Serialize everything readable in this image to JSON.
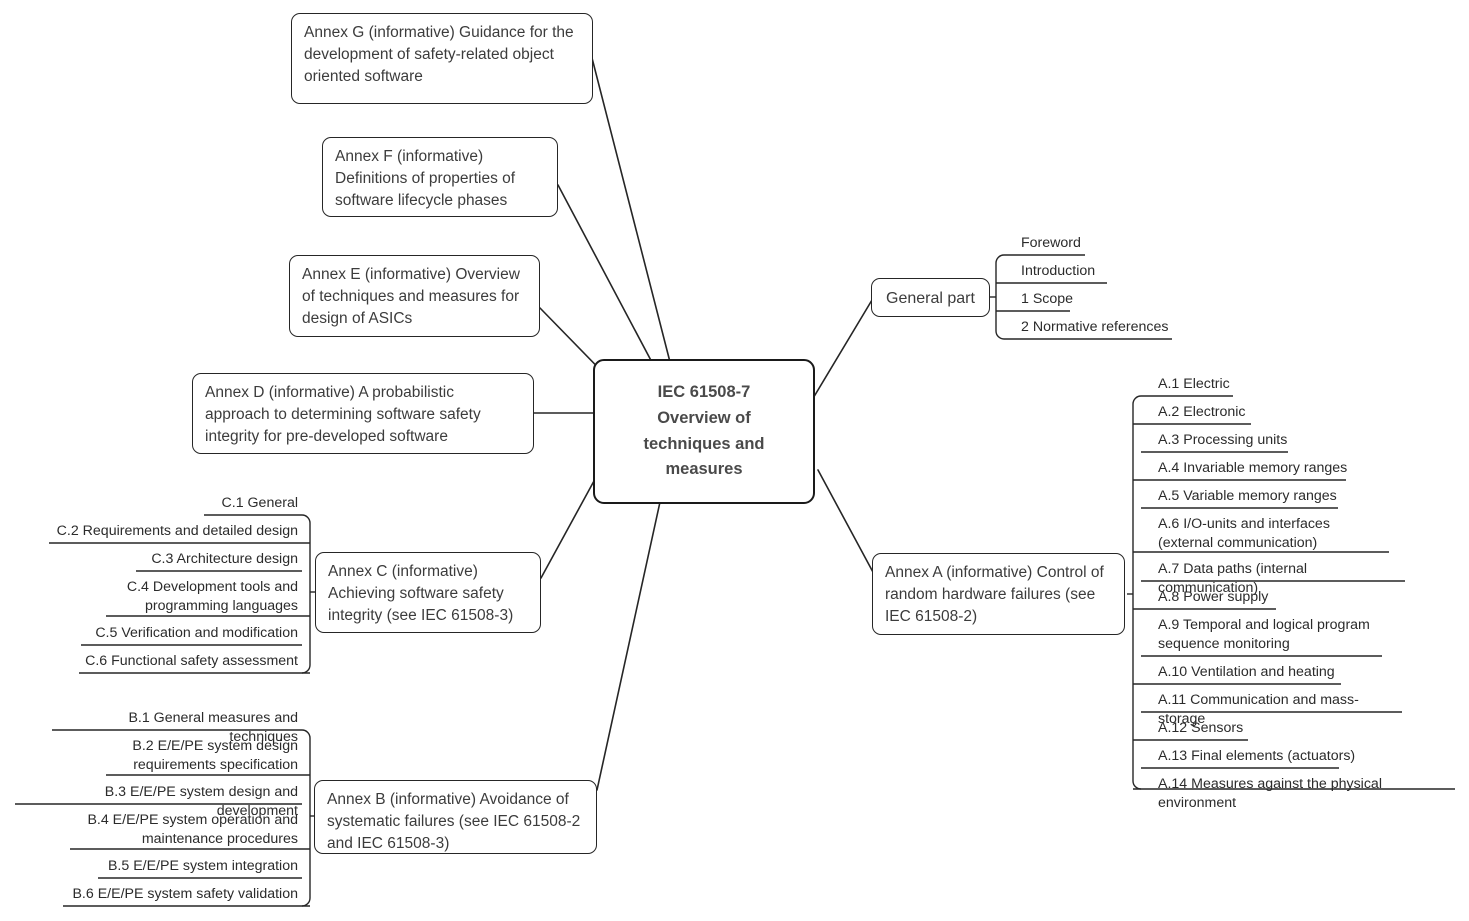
{
  "diagram": {
    "type": "mind-map",
    "title": "IEC 61508-7 Overview of techniques and measures",
    "line_color": "#262626",
    "text_color": "#3c3c3c",
    "background": "#ffffff"
  },
  "center": {
    "label": "IEC 61508-7 Overview of techniques and measures",
    "line1": "IEC 61508-7",
    "line2": "Overview of",
    "line3": "techniques and",
    "line4": "measures"
  },
  "branches": {
    "annex_g": {
      "label": "Annex G (informative) Guidance for the development of safety-related object oriented software"
    },
    "annex_f": {
      "label": "Annex F (informative) Definitions of properties of software lifecycle phases"
    },
    "annex_e": {
      "label": "Annex E (informative) Overview of techniques and measures for design of ASICs"
    },
    "annex_d": {
      "label": "Annex D (informative) A probabilistic approach to determining software safety integrity for pre-developed software"
    },
    "annex_c": {
      "label": "Annex C (informative) Achieving software safety integrity (see IEC 61508-3)",
      "children": [
        "C.1 General",
        "C.2 Requirements and detailed design",
        "C.3 Architecture design",
        "C.4 Development tools and programming languages",
        "C.5 Verification and modification",
        "C.6 Functional safety assessment"
      ]
    },
    "annex_b": {
      "label": "Annex B (informative) Avoidance of systematic failures (see IEC 61508-2 and IEC 61508-3)",
      "children": [
        "B.1 General measures and techniques",
        "B.2 E/E/PE system design requirements specification",
        "B.3 E/E/PE system design and development",
        "B.4 E/E/PE system operation and maintenance procedures",
        "B.5 E/E/PE system integration",
        "B.6 E/E/PE system safety validation"
      ]
    },
    "general_part": {
      "label": "General part",
      "children": [
        "Foreword",
        "Introduction",
        "1 Scope",
        "2 Normative references"
      ]
    },
    "annex_a": {
      "label": "Annex A (informative) Control of random hardware failures (see IEC 61508-2)",
      "children": [
        "A.1 Electric",
        "A.2 Electronic",
        "A.3 Processing units",
        "A.4 Invariable memory ranges",
        "A.5 Variable memory ranges",
        "A.6 I/O-units and interfaces (external communication)",
        "A.7 Data paths (internal communication)",
        "A.8 Power supply",
        "A.9 Temporal and logical program sequence monitoring",
        "A.10 Ventilation and heating",
        "A.11 Communication and mass-storage",
        "A.12 Sensors",
        "A.13 Final elements (actuators)",
        "A.14 Measures against the physical environment"
      ]
    }
  }
}
